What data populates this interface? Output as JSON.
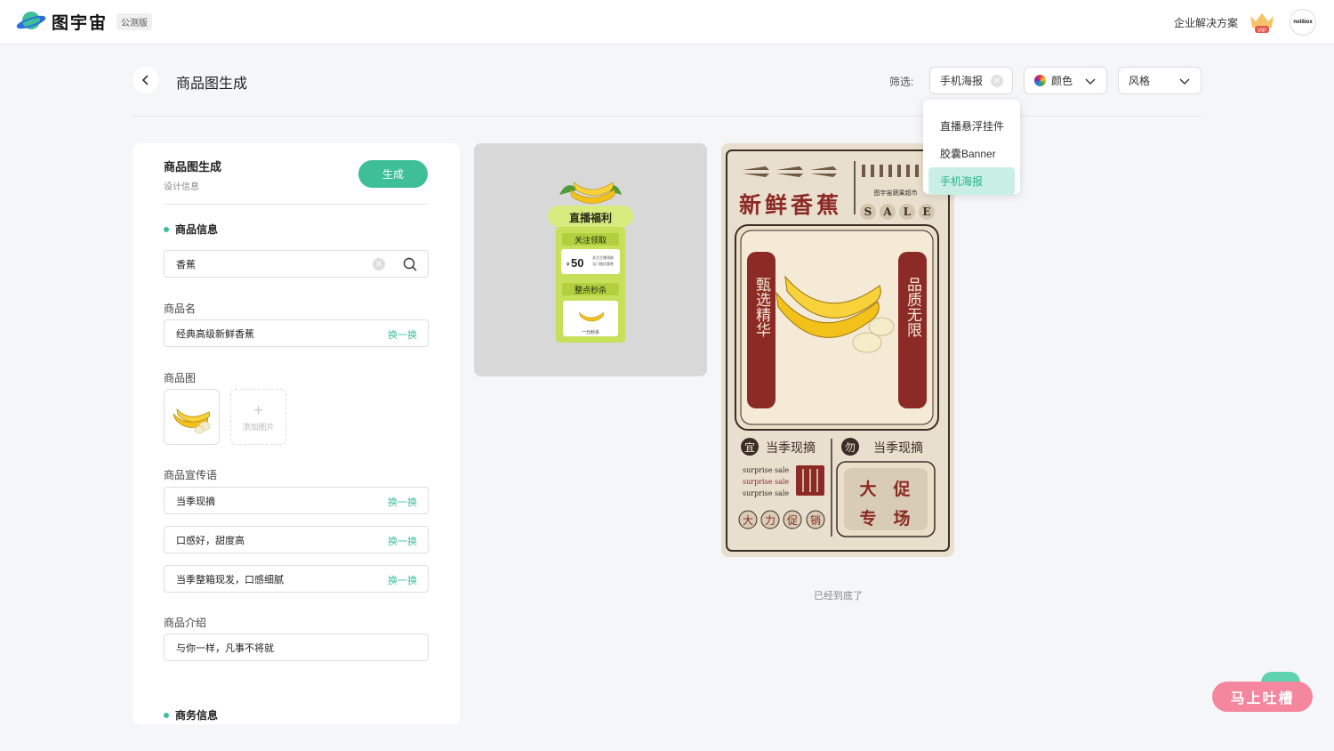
{
  "header": {
    "brand": "图宇宙",
    "beta_badge": "公测版",
    "enterprise_link": "企业解决方案",
    "vip_label": "VIP",
    "avatar_text": "nolibox"
  },
  "page": {
    "title": "商品图生成",
    "filter_label": "筛选:",
    "filters": {
      "type_value": "手机海报",
      "color_label": "颜色",
      "style_label": "风格"
    },
    "dropdown": {
      "items": [
        "直播悬浮挂件",
        "胶囊Banner",
        "手机海报"
      ],
      "selected_index": 2
    }
  },
  "panel": {
    "title": "商品图生成",
    "subtitle": "设计信息",
    "generate_button": "生成",
    "section_product": "商品信息",
    "search_value": "香蕉",
    "name_label": "商品名",
    "name_value": "经典高级新鲜香蕉",
    "swap_label": "换一换",
    "image_label": "商品图",
    "add_image_label": "添加图片",
    "slogan_label": "商品宣传语",
    "slogans": [
      "当季现摘",
      "口感好，甜度高",
      "当季整箱现发，口感细腻"
    ],
    "intro_label": "商品介绍",
    "intro_value": "与你一样，凡事不将就",
    "section_business": "商务信息"
  },
  "preview1": {
    "title": "直播福利",
    "follow_label": "关注领取",
    "coupon_symbol": "¥",
    "coupon_value": "50",
    "coupon_note1": "关注主播领取",
    "coupon_note2": "无门槛优惠券",
    "flash_label": "整点秒杀",
    "one_yuan_label": "一元秒杀"
  },
  "preview2": {
    "store_name": "图宇宙蔬果超市",
    "headline": "新鲜香蕉",
    "sale_letters": [
      "S",
      "A",
      "L",
      "E"
    ],
    "left_banner": "甄选精华",
    "right_banner": "品质无限",
    "tag1_char": "宜",
    "tag1_text": "当季现摘",
    "tag2_char": "勿",
    "tag2_text": "当季现摘",
    "surprise_lines": [
      "surprise sale",
      "surprise sale",
      "surprise sale"
    ],
    "promo_chars": [
      "大",
      "力",
      "促",
      "销"
    ],
    "stamp_chars": [
      "大",
      "促",
      "专",
      "场"
    ]
  },
  "bottom_note": "已经到底了",
  "feedback_button": "马上吐槽",
  "colors": {
    "accent": "#3ebf98",
    "poster_red": "#8c2a25",
    "poster_bg": "#e9dfcf",
    "feedback": "#f4869d"
  }
}
